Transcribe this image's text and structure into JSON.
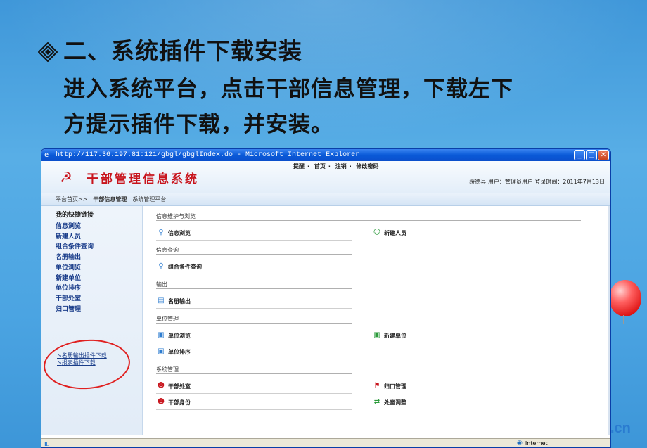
{
  "slide": {
    "title": "二、系统插件下载安装",
    "line1": "进入系统平台，点击干部信息管理，下载左下",
    "line2": "方提示插件下载，并安装。",
    "bullet_icon": "diamond-bullet-icon",
    "corner_logo": ".cn"
  },
  "browser": {
    "title": "http://117.36.197.81:121/gbgl/gbglIndex.do - Microsoft Internet Explorer",
    "buttons": {
      "minimize": "_",
      "maximize": "□",
      "close": "✕"
    },
    "status": {
      "zone": "Internet"
    }
  },
  "app": {
    "system_name": "干部管理信息系统",
    "top_links": [
      "提醒",
      "首页",
      "注销",
      "修改密码"
    ],
    "user_info": "绥德县  用户：管理员用户  登录时间：2011年7月13日",
    "breadcrumb": [
      "平台首页>>",
      "干部信息管理",
      "系统管理平台"
    ]
  },
  "sidebar": {
    "title": "我的快捷链接",
    "items": [
      "信息浏览",
      "新建人员",
      "组合条件查询",
      "名册输出",
      "单位浏览",
      "新建单位",
      "单位排序",
      "干部处室",
      "归口管理"
    ],
    "plugin_links": [
      "名册输出插件下载",
      "报表插件下载"
    ]
  },
  "main": {
    "sections": [
      {
        "title": "信息维护与浏览",
        "items": [
          "信息浏览",
          "新建人员"
        ]
      },
      {
        "title": "信息查询",
        "items": [
          "组合条件查询"
        ]
      },
      {
        "title": "输出",
        "items": [
          "名册输出"
        ]
      },
      {
        "title": "单位管理",
        "items": [
          "单位浏览",
          "新建单位",
          "单位排序"
        ]
      },
      {
        "title": "系统管理",
        "items": [
          "干部处室",
          "归口管理",
          "干部身份",
          "处室调整"
        ]
      }
    ]
  },
  "colors": {
    "slide_bg": "#4ba4e2",
    "title_bar": "#0a5ad8",
    "brand_red": "#c8141c",
    "link_blue": "#1a3d8a",
    "annotation_circle": "#e02020"
  }
}
